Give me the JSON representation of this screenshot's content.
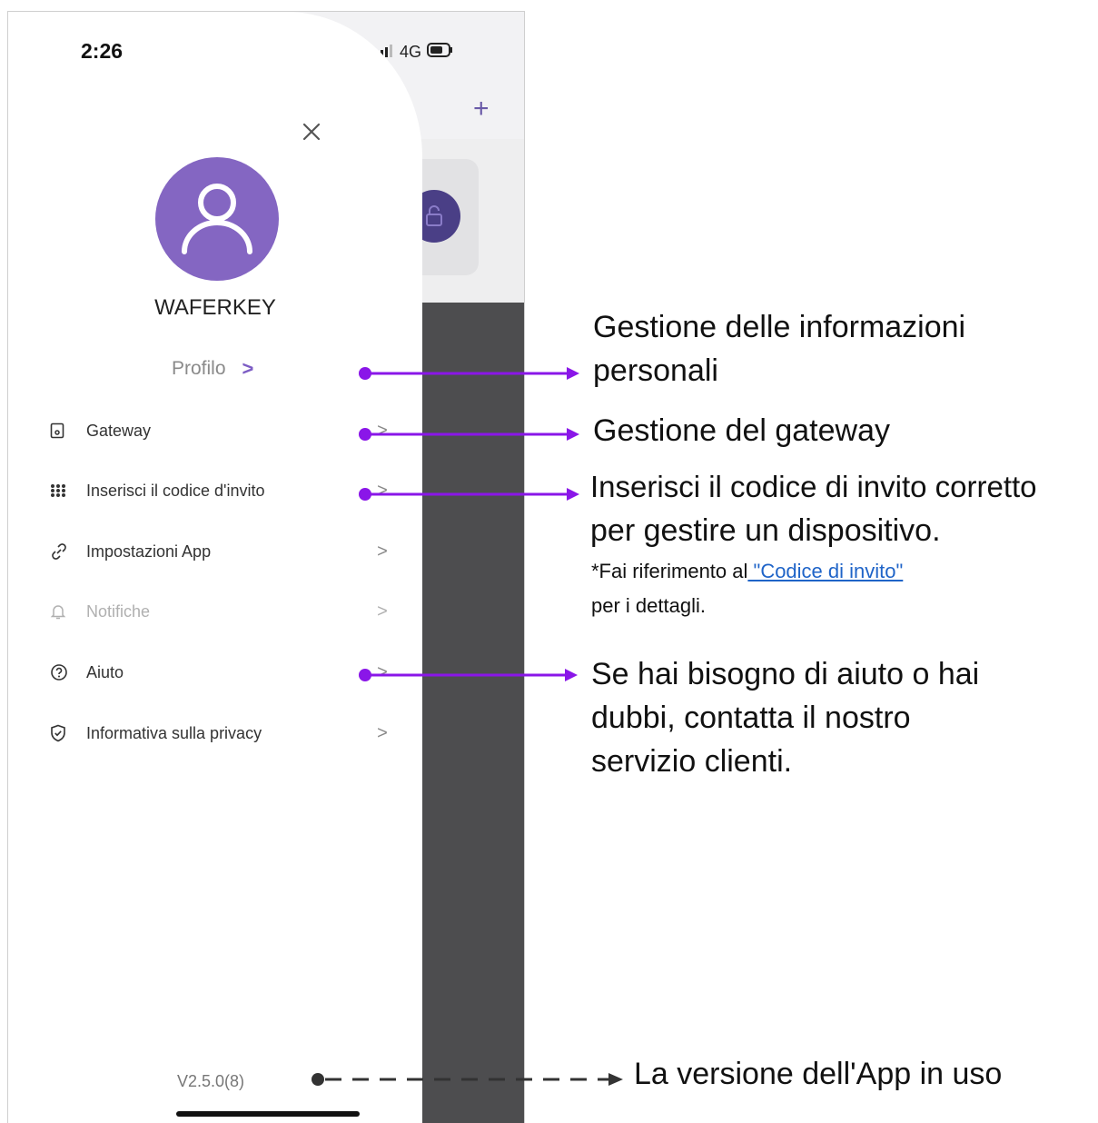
{
  "status_bar": {
    "time": "2:26",
    "network": "4G"
  },
  "drawer": {
    "username": "WAFERKEY",
    "profile_label": "Profilo",
    "profile_chevron": ">",
    "menu": [
      {
        "label": "Gateway",
        "icon": "gateway-icon",
        "chevron": ">",
        "enabled": true
      },
      {
        "label": "Inserisci il codice d'invito",
        "icon": "grid-dots-icon",
        "chevron": ">",
        "enabled": true
      },
      {
        "label": "Impostazioni App",
        "icon": "link-icon",
        "chevron": ">",
        "enabled": true
      },
      {
        "label": "Notifiche",
        "icon": "bell-icon",
        "chevron": ">",
        "enabled": false
      },
      {
        "label": "Aiuto",
        "icon": "help-circle-icon",
        "chevron": ">",
        "enabled": true
      },
      {
        "label": "Informativa sulla privacy",
        "icon": "shield-check-icon",
        "chevron": ">",
        "enabled": true
      }
    ],
    "version": "V2.5.0(8)"
  },
  "annotations": {
    "profile_line1": "Gestione delle informazioni",
    "profile_line2": "personali",
    "gateway": "Gestione del gateway",
    "invite_line1": "Inserisci il codice di invito corretto",
    "invite_line2": "per gestire un dispositivo.",
    "invite_note_prefix": "*Fai riferimento al",
    "invite_note_link": " \"Codice di invito\" ",
    "invite_note_suffix": "per i dettagli.",
    "help_line1": "Se hai bisogno di aiuto o hai",
    "help_line2": "dubbi, contatta il nostro",
    "help_line3": "servizio clienti.",
    "version": "La versione dell'App in uso"
  },
  "colors": {
    "accent_purple": "#8466c2",
    "arrow_purple": "#8a16e8",
    "link_blue": "#1f64c8",
    "dark_overlay": "#4d4d4f"
  }
}
